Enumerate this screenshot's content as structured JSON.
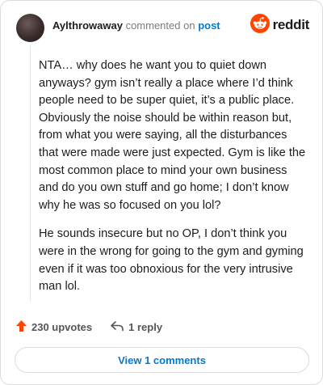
{
  "comment": {
    "username": "Aylthrowaway",
    "action_text": "commented on",
    "link_text": "post",
    "paragraphs": [
      "NTA… why does he want you to quiet down anyways? gym isn’t really a place where I’d think people need to be super quiet, it’s a public place. Obviously the noise should be within reason but, from what you were saying, all the disturbances that were made were just expected. Gym is like the most common place to mind your own business and do you own stuff and go home; I don’t know why he was so focused on you lol?",
      "He sounds insecure but no OP, I don’t think you were in the wrong for going to the gym and gyming even if it was too obnoxious for the very intrusive man lol."
    ]
  },
  "brand": {
    "name": "reddit",
    "icon": "reddit-alien-icon",
    "color": "#ff4500"
  },
  "actions": {
    "upvotes_label": "230 upvotes",
    "reply_label": "1 reply",
    "upvote_icon": "upvote-arrow-icon",
    "reply_icon": "reply-arrow-icon"
  },
  "footer": {
    "view_comments_label": "View 1 comments"
  },
  "colors": {
    "link": "#0079d3",
    "upvote": "#ff4500",
    "text": "#1c1c1c",
    "muted": "#7c7c7c"
  }
}
